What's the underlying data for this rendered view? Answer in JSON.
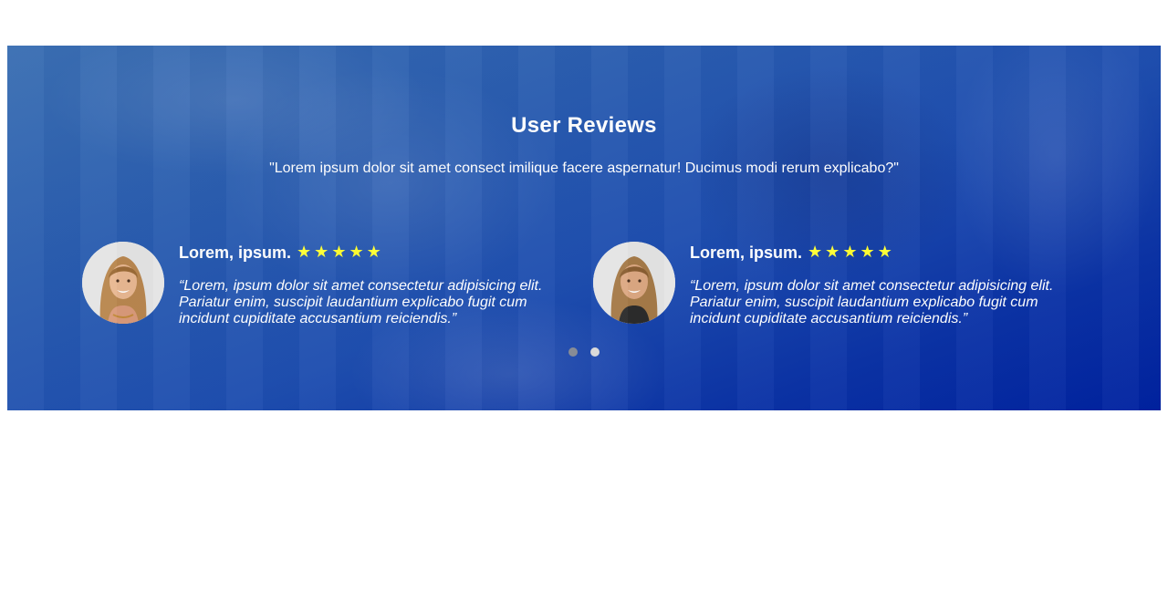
{
  "section": {
    "title": "User Reviews",
    "subtitle": "\"Lorem ipsum dolor sit amet consect imilique facere aspernatur! Ducimus modi rerum explicabo?\""
  },
  "reviews": [
    {
      "name": "Lorem, ipsum.",
      "rating": 5,
      "stars": [
        "★",
        "★",
        "★",
        "★",
        "★"
      ],
      "quote": "“Lorem, ipsum dolor sit amet consectetur adipisicing elit. Pariatur enim, suscipit laudantium explicabo fugit cum incidunt cupiditate accusantium reiciendis.”"
    },
    {
      "name": "Lorem, ipsum.",
      "rating": 5,
      "stars": [
        "★",
        "★",
        "★",
        "★",
        "★"
      ],
      "quote": "“Lorem, ipsum dolor sit amet consectetur adipisicing elit. Pariatur enim, suscipit laudantium explicabo fugit cum incidunt cupiditate accusantium reiciendis.”"
    }
  ],
  "carousel": {
    "page_count": 2,
    "active_index": 0
  },
  "colors": {
    "banner_blue": "#1f4fb0",
    "star_yellow": "#ffff33",
    "dot_active": "#8a8f99",
    "dot_inactive": "#d9d9d9"
  }
}
